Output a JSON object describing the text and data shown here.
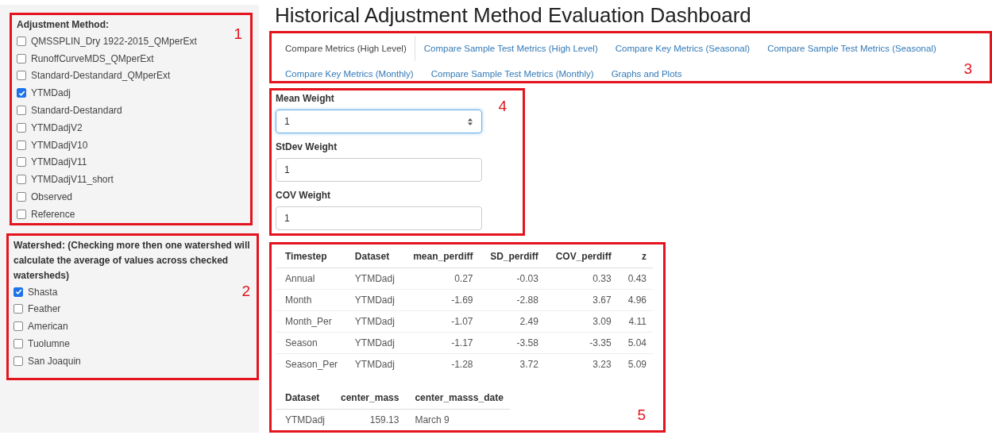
{
  "title": "Historical Adjustment Method Evaluation Dashboard",
  "adjustment_method": {
    "label": "Adjustment Method:",
    "callout": "1",
    "options": [
      {
        "label": "QMSSPLIN_Dry 1922-2015_QMperExt",
        "checked": false
      },
      {
        "label": "RunoffCurveMDS_QMperExt",
        "checked": false
      },
      {
        "label": "Standard-Destandard_QMperExt",
        "checked": false
      },
      {
        "label": "YTMDadj",
        "checked": true
      },
      {
        "label": "Standard-Destandard",
        "checked": false
      },
      {
        "label": "YTMDadjV2",
        "checked": false
      },
      {
        "label": "YTMDadjV10",
        "checked": false
      },
      {
        "label": "YTMDadjV11",
        "checked": false
      },
      {
        "label": "YTMDadjV11_short",
        "checked": false
      },
      {
        "label": "Observed",
        "checked": false
      },
      {
        "label": "Reference",
        "checked": false
      }
    ]
  },
  "watershed": {
    "label": "Watershed: (Checking more then one watershed will calculate the average of values across checked watersheds)",
    "callout": "2",
    "options": [
      {
        "label": "Shasta",
        "checked": true
      },
      {
        "label": "Feather",
        "checked": false
      },
      {
        "label": "American",
        "checked": false
      },
      {
        "label": "Tuolumne",
        "checked": false
      },
      {
        "label": "San Joaquin",
        "checked": false
      }
    ]
  },
  "tabs": {
    "callout": "3",
    "items": [
      {
        "label": "Compare Metrics (High Level)",
        "selected": true
      },
      {
        "label": "Compare Sample Test Metrics (High Level)",
        "selected": false
      },
      {
        "label": "Compare Key Metrics (Seasonal)",
        "selected": false
      },
      {
        "label": "Compare Sample Test Metrics (Seasonal)",
        "selected": false
      },
      {
        "label": "Compare Key Metrics (Monthly)",
        "selected": false
      },
      {
        "label": "Compare Sample Test Metrics (Monthly)",
        "selected": false
      },
      {
        "label": "Graphs and Plots",
        "selected": false
      }
    ]
  },
  "weights": {
    "callout": "4",
    "fields": [
      {
        "label": "Mean Weight",
        "value": "1",
        "focused": true
      },
      {
        "label": "StDev Weight",
        "value": "1",
        "focused": false
      },
      {
        "label": "COV Weight",
        "value": "1",
        "focused": false
      }
    ]
  },
  "results": {
    "callout": "5",
    "metrics_table": {
      "columns": [
        "Timestep",
        "Dataset",
        "mean_perdiff",
        "SD_perdiff",
        "COV_perdiff",
        "z"
      ],
      "rows": [
        [
          "Annual",
          "YTMDadj",
          "0.27",
          "-0.03",
          "0.33",
          "0.43"
        ],
        [
          "Month",
          "YTMDadj",
          "-1.69",
          "-2.88",
          "3.67",
          "4.96"
        ],
        [
          "Month_Per",
          "YTMDadj",
          "-1.07",
          "2.49",
          "3.09",
          "4.11"
        ],
        [
          "Season",
          "YTMDadj",
          "-1.17",
          "-3.58",
          "-3.35",
          "5.04"
        ],
        [
          "Season_Per",
          "YTMDadj",
          "-1.28",
          "3.72",
          "3.23",
          "5.09"
        ]
      ]
    },
    "center_table": {
      "columns": [
        "Dataset",
        "center_mass",
        "center_masss_date"
      ],
      "rows": [
        [
          "YTMDadj",
          "159.13",
          "March 9"
        ]
      ]
    }
  }
}
